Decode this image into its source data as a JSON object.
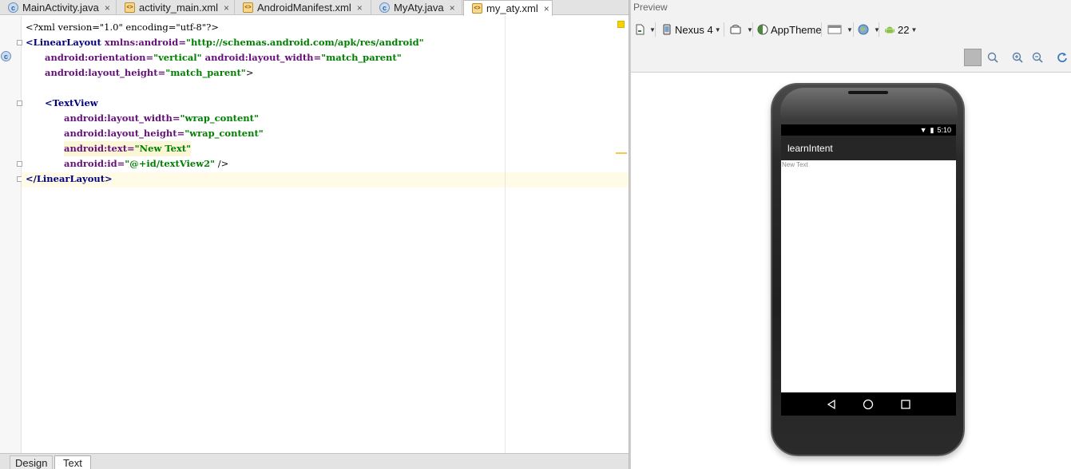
{
  "editor": {
    "tabs": [
      {
        "label": "MainActivity.java",
        "icon": "class-icon"
      },
      {
        "label": "activity_main.xml",
        "icon": "xml-file-icon"
      },
      {
        "label": "AndroidManifest.xml",
        "icon": "xml-file-icon"
      },
      {
        "label": "MyAty.java",
        "icon": "class-icon"
      },
      {
        "label": "my_aty.xml",
        "icon": "xml-file-icon",
        "active": true
      }
    ],
    "close_glyph": "×",
    "code": {
      "l1": "<?xml version=\"1.0\" encoding=\"utf-8\"?>",
      "l2_tag": "<LinearLayout",
      "l2_attr": " xmlns:android=",
      "l2_val": "\"http://schemas.android.com/apk/res/android\"",
      "l3_attr1": "android:orientation=",
      "l3_val1": "\"vertical\"",
      "l3_attr2": " android:layout_width=",
      "l3_val2": "\"match_parent\"",
      "l4_attr": "android:layout_height=",
      "l4_val": "\"match_parent\"",
      "l4_end": ">",
      "l6_tag": "<TextView",
      "l7_attr": "android:layout_width=",
      "l7_val": "\"wrap_content\"",
      "l8_attr": "android:layout_height=",
      "l8_val": "\"wrap_content\"",
      "l9_attr": "android:text=",
      "l9_val": "\"New Text\"",
      "l10_attr": "android:id=",
      "l10_val": "\"@+id/textView2\"",
      "l10_end": " />",
      "l11_tag": "</LinearLayout>"
    },
    "bottom_tabs": {
      "design": "Design",
      "text": "Text"
    }
  },
  "preview": {
    "title": "Preview",
    "toolbar": {
      "device": "Nexus 4",
      "theme": "AppTheme",
      "api": "22"
    },
    "phone": {
      "time": "5:10",
      "app_title": "learnIntent",
      "content_text": "New Text"
    }
  }
}
